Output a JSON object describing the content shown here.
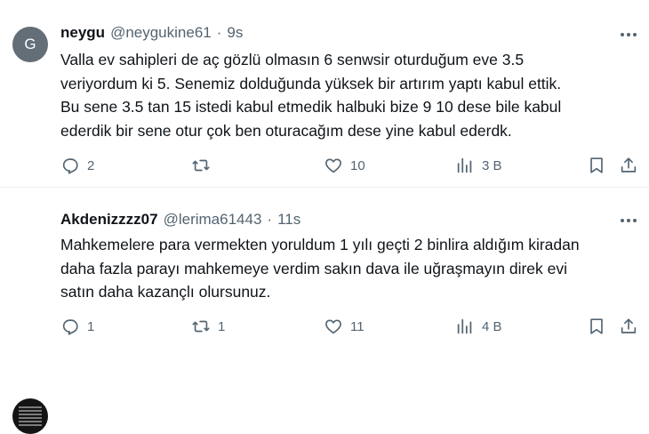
{
  "tweets": [
    {
      "avatar_letter": "G",
      "display_name": "neygu",
      "handle": "@neygukine61",
      "separator": "·",
      "time": "9s",
      "lines": [
        "Valla ev sahipleri de aç gözlü olmasın 6 senwsir oturduğum eve 3.5",
        "veriyordum ki 5. Senemiz dolduğunda yüksek bir artırım yaptı kabul ettik.",
        "Bu sene 3.5 tan 15 istedi kabul etmedik halbuki bize 9 10 dese bile kabul",
        "ederdik bir sene otur çok ben oturacağım dese yine kabul ederdk."
      ],
      "reply_count": "2",
      "retweet_count": "",
      "like_count": "10",
      "views": "3 B"
    },
    {
      "display_name": "Akdenizzzz07",
      "handle": "@lerima61443",
      "separator": "·",
      "time": "11s",
      "lines": [
        "Mahkemelere para vermekten yoruldum 1 yılı geçti 2 binlira aldığım kiradan",
        "daha fazla parayı mahkemeye verdim sakın dava ile uğraşmayın direk evi",
        "satın daha kazançlı olursunuz."
      ],
      "reply_count": "1",
      "retweet_count": "1",
      "like_count": "11",
      "views": "4 B"
    }
  ],
  "icons": {
    "reply": "reply-icon",
    "retweet": "retweet-icon",
    "like": "heart-icon",
    "views": "views-icon",
    "bookmark": "bookmark-icon",
    "share": "share-icon",
    "more": "more-icon"
  },
  "colors": {
    "text": "#0f1419",
    "secondary": "#536471",
    "divider": "#eff3f4"
  }
}
